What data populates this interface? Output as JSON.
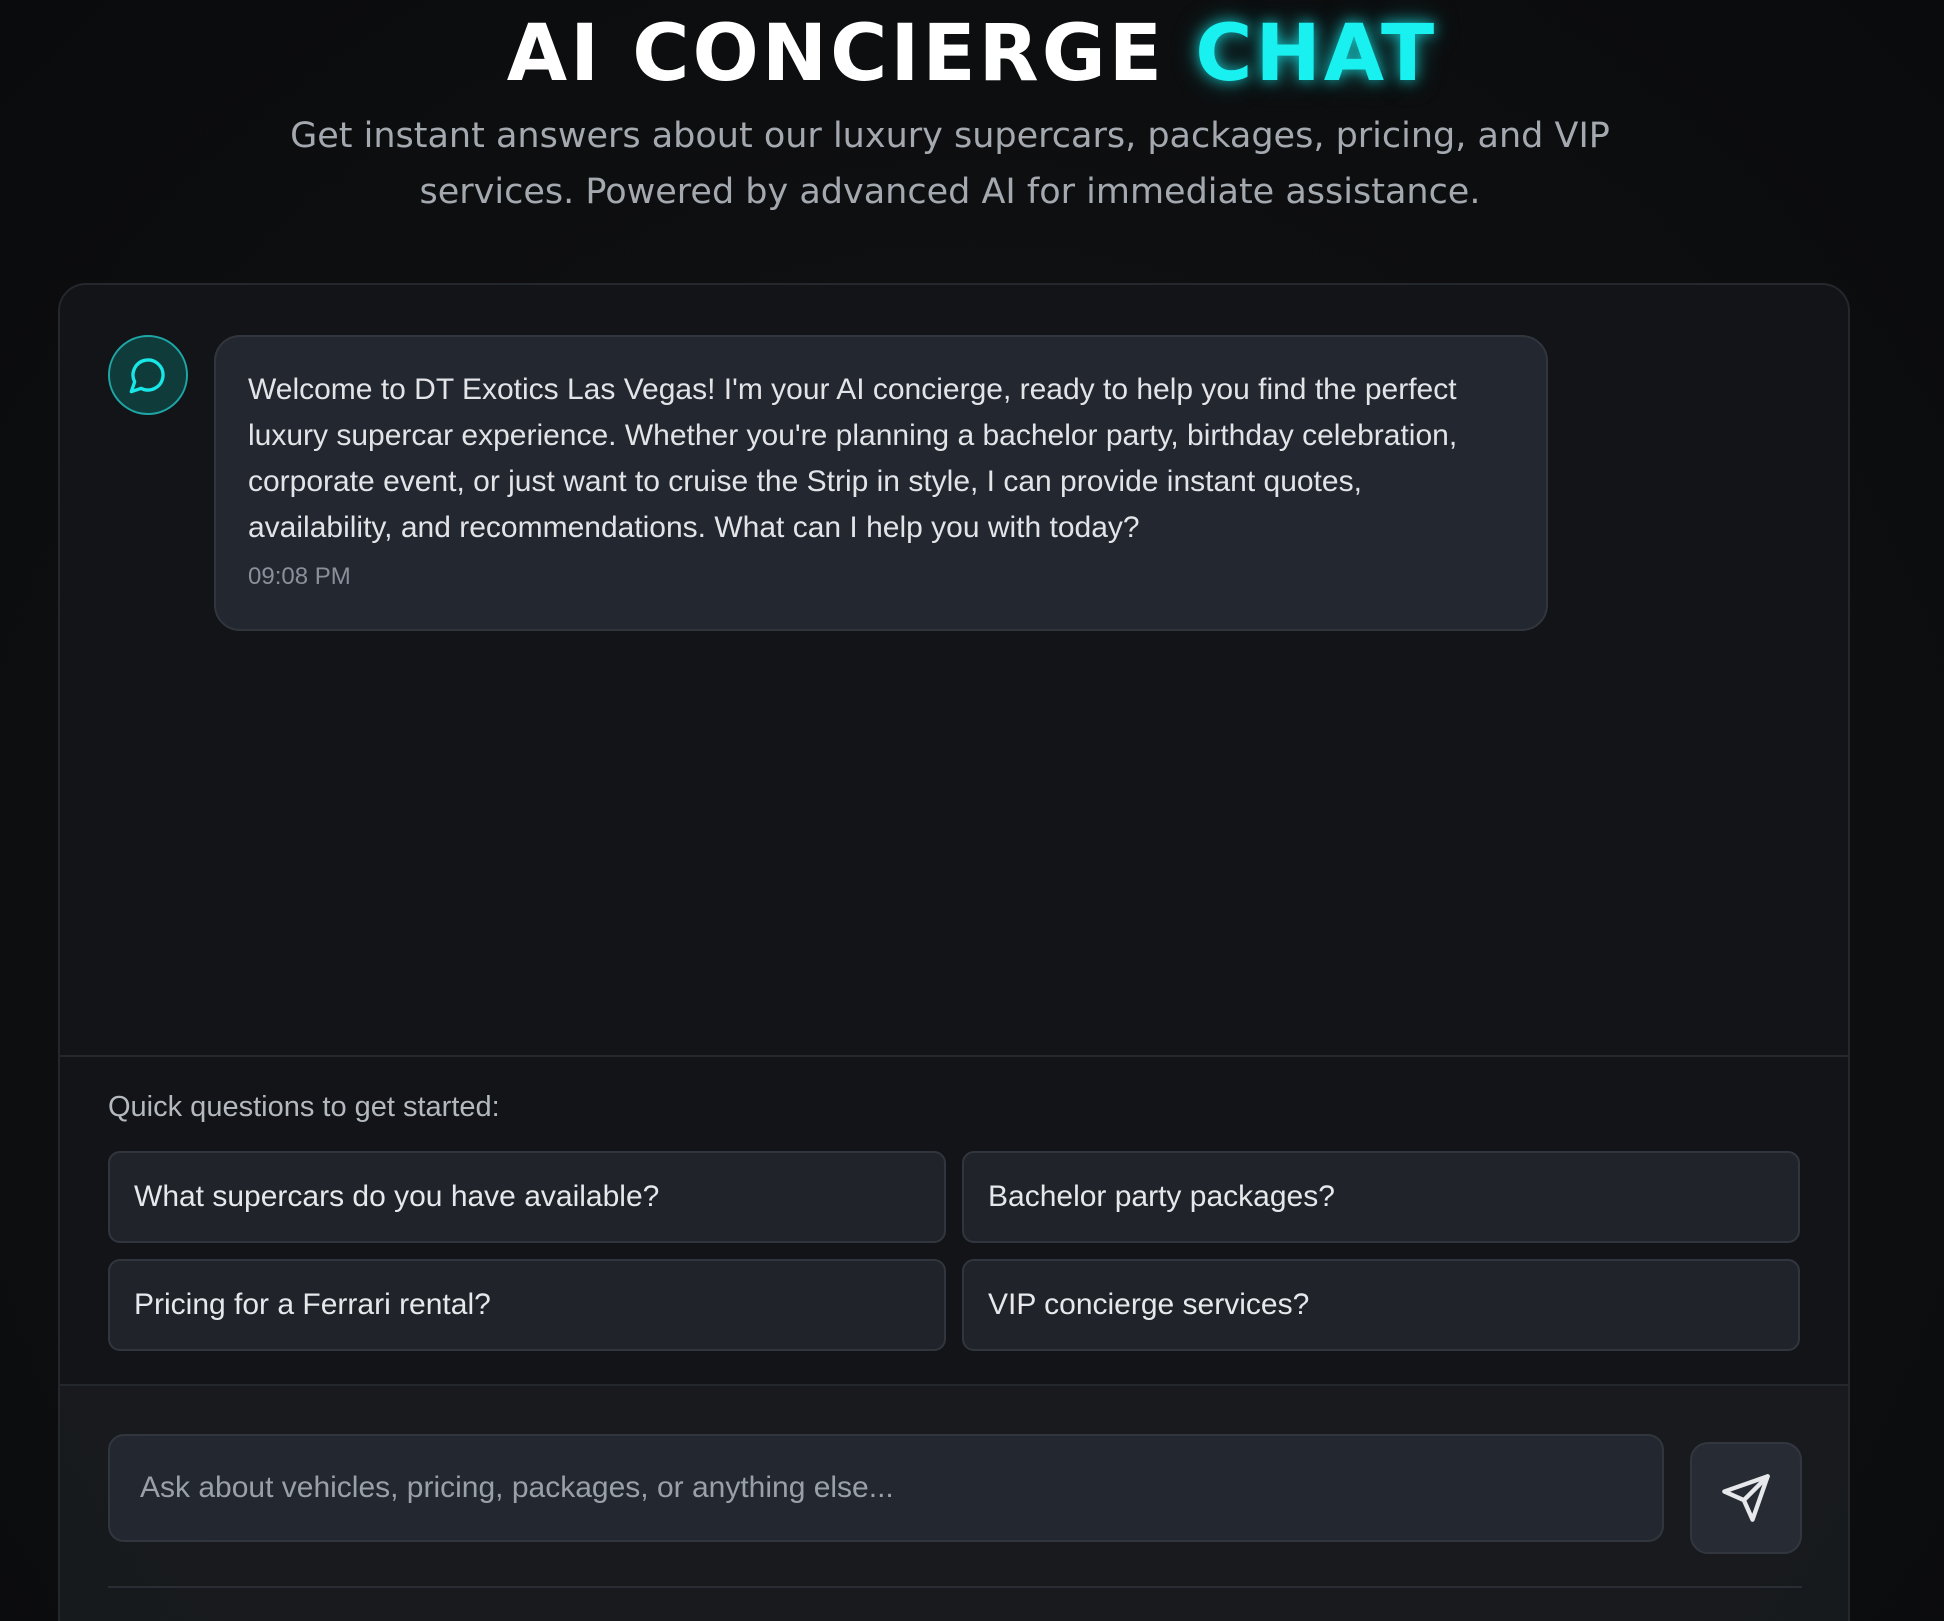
{
  "hero": {
    "title_main": "AI CONCIERGE",
    "title_accent": "CHAT",
    "subtitle": "Get instant answers about our luxury supercars, packages, pricing, and VIP services. Powered by advanced AI for immediate assistance."
  },
  "chat": {
    "avatar_icon": "chat-bubble-icon",
    "messages": [
      {
        "sender": "assistant",
        "text": "Welcome to DT Exotics Las Vegas! I'm your AI concierge, ready to help you find the perfect luxury supercar experience. Whether you're planning a bachelor party, birthday celebration, corporate event, or just want to cruise the Strip in style, I can provide instant quotes, availability, and recommendations. What can I help you with today?",
        "time": "09:08 PM"
      }
    ]
  },
  "quick_questions": {
    "label": "Quick questions to get started:",
    "items": [
      "What supercars do you have available?",
      "Bachelor party packages?",
      "Pricing for a Ferrari rental?",
      "VIP concierge services?"
    ]
  },
  "composer": {
    "value": "",
    "placeholder": "Ask about vehicles, pricing, packages, or anything else...",
    "send_icon": "send-icon"
  },
  "colors": {
    "accent": "#19f0f0",
    "background": "#0e0f11",
    "panel": "#131518",
    "bubble": "#232830"
  }
}
